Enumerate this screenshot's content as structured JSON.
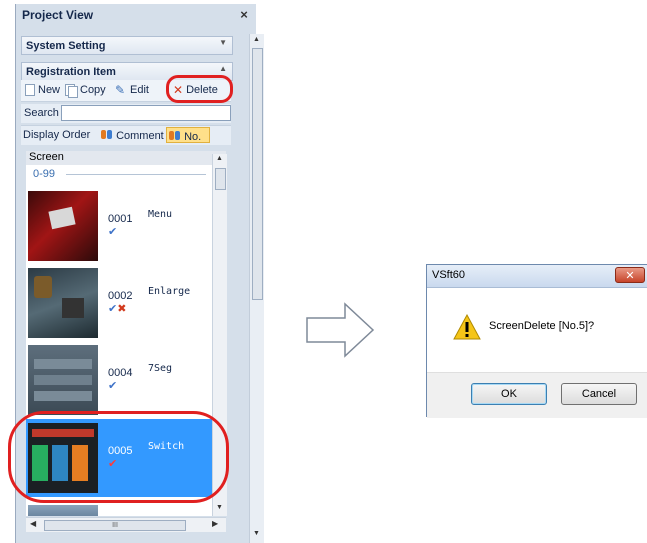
{
  "project_view": {
    "title": "Project View",
    "close_glyph": "×",
    "system_setting": "System Setting",
    "registration_item": "Registration Item",
    "toolbar": {
      "new": "New",
      "copy": "Copy",
      "edit": "Edit",
      "delete": "Delete"
    },
    "search_label": "Search",
    "sort": {
      "display_order": "Display Order",
      "comment": "Comment",
      "no": "No."
    },
    "list": {
      "section": "Screen",
      "group": "0-99",
      "items": [
        {
          "num": "0001",
          "name": "Menu",
          "selected": false
        },
        {
          "num": "0002",
          "name": "Enlarge",
          "selected": false
        },
        {
          "num": "0004",
          "name": "7Seg",
          "selected": false
        },
        {
          "num": "0005",
          "name": "Switch",
          "selected": true
        }
      ]
    },
    "hscroll_grip": "III"
  },
  "dialog": {
    "title": "VSft60",
    "message": "ScreenDelete [No.5]?",
    "ok": "OK",
    "cancel": "Cancel"
  },
  "colors": {
    "selection": "#3399ff",
    "highlight_ring": "#e02020",
    "panel_bg": "#d5dfea"
  }
}
